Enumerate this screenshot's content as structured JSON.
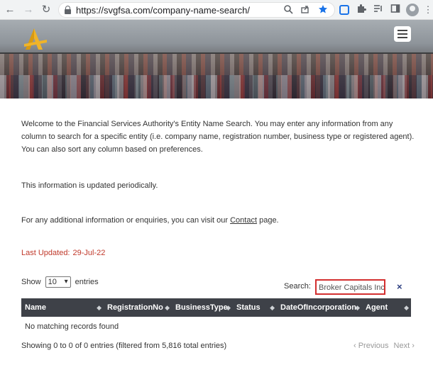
{
  "browser": {
    "url": "https://svgfsa.com/company-name-search/",
    "back_glyph": "←",
    "forward_glyph": "→",
    "reload_glyph": "↻"
  },
  "icons": {
    "back": "arrow-left-icon",
    "forward": "arrow-right-icon",
    "reload": "reload-icon",
    "lock": "lock-icon",
    "zoom": "search-icon",
    "share": "share-icon",
    "bookmark": "star-icon",
    "extension": "extension-icon",
    "puzzle": "puzzle-icon",
    "reading_list": "reading-list-icon",
    "side_panel": "side-panel-icon",
    "profile": "profile-icon",
    "menu": "hamburger-menu-icon",
    "logo": "fsa-logo-icon"
  },
  "colors": {
    "bookmark_star": "#1a73e8",
    "last_updated": "#c0392b",
    "table_header": "#3e4148",
    "search_highlight": "#d32f2f",
    "logo": "#f0b429"
  },
  "intro": {
    "text": "Welcome to the Financial Services Authority's Entity Name Search. You may enter any information from any column to search for a specific entity (i.e. company name, registration number, business type or registered agent). You can also sort any column based on preferences.",
    "updated_note": "This information is updated periodically.",
    "enquiry_prefix": "For any additional information or enquiries, you can visit our ",
    "contact_link": "Contact",
    "enquiry_suffix": " page."
  },
  "last_updated": {
    "label": "Last Updated:",
    "date": "29-Jul-22"
  },
  "table_controls": {
    "show_label": "Show",
    "entries_value": "10",
    "entries_label": "entries",
    "search_label": "Search:",
    "search_value": "Broker Capitals Inc",
    "clear_glyph": "×"
  },
  "table": {
    "columns": [
      "Name",
      "RegistrationNo",
      "BusinessType",
      "Status",
      "DateOfIncorporation",
      "Agent"
    ],
    "sort_glyph": "◆",
    "empty_message": "No matching records found"
  },
  "footer": {
    "info": "Showing 0 to 0 of 0 entries (filtered from 5,816 total entries)",
    "previous": "‹ Previous",
    "next": "Next ›"
  }
}
